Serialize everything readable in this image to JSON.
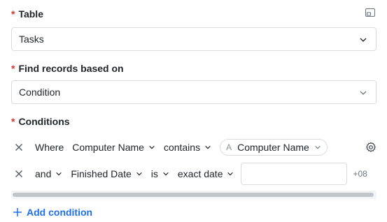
{
  "table": {
    "label": "Table",
    "required_mark": "*",
    "selected": "Tasks"
  },
  "find_records": {
    "label": "Find records based on",
    "required_mark": "*",
    "selected": "Condition"
  },
  "conditions": {
    "label": "Conditions",
    "required_mark": "*",
    "rows": [
      {
        "conjunction": "Where",
        "field": "Computer Name",
        "operator": "contains",
        "value_field": "Computer Name",
        "value_field_icon": "A"
      },
      {
        "conjunction": "and",
        "field": "Finished Date",
        "operator": "is",
        "date_mode": "exact date",
        "value": "",
        "timezone": "+08"
      }
    ],
    "add_label": "Add condition"
  },
  "colors": {
    "accent": "#1f6feb",
    "required": "#d9342b",
    "border": "#d8dbe0"
  },
  "icons": {
    "layout": "layout-icon",
    "chevron": "chevron-down-icon",
    "remove": "close-icon",
    "settings": "gear-icon",
    "add": "plus-icon"
  }
}
